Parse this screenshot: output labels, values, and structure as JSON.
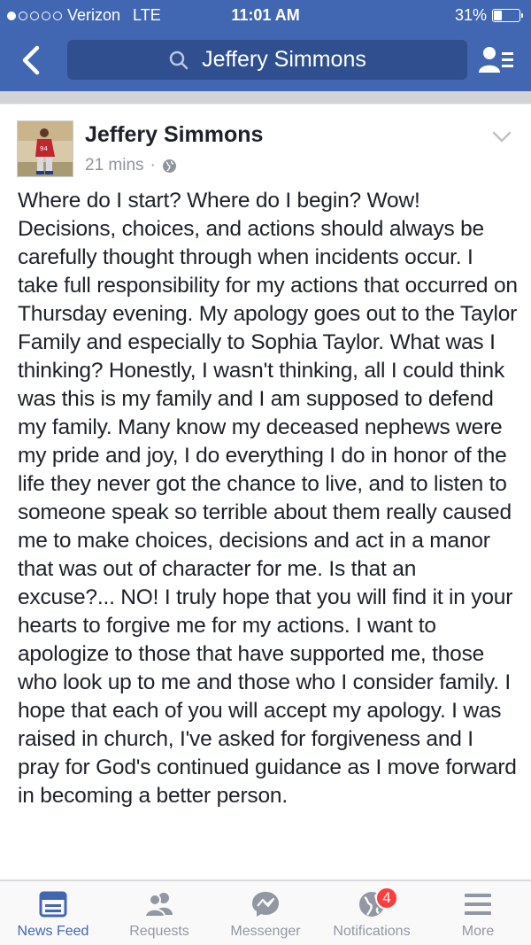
{
  "status_bar": {
    "carrier": "Verizon",
    "network": "LTE",
    "time": "11:01 AM",
    "battery": "31%",
    "battery_level": 0.31,
    "signal_bars_filled": 1
  },
  "nav": {
    "search_text": "Jeffery Simmons"
  },
  "post": {
    "author": "Jeffery Simmons",
    "time": "21 mins",
    "separator": "·",
    "audience_icon": "globe-icon",
    "text": "Where do I start? Where do I begin? Wow! Decisions, choices, and actions should always be carefully thought through when incidents occur. I take full responsibility for my actions that occurred on Thursday evening. My apology goes out to the Taylor Family and especially to Sophia Taylor. What was I thinking? Honestly, I wasn't thinking, all I could think was this is my family and I am supposed to defend my family. Many know my deceased nephews were my pride and joy, I do everything I do in honor of the life they never got the chance to live, and to listen to someone speak so terrible about them really caused me to make choices, decisions and act in a manor that was out of character for me. Is that an excuse?... NO! I truly hope that you will find it in your hearts to forgive me for my actions. I want to apologize to those that have supported me, those who look up to me and those who I consider family. I hope that each of you will accept my apology. I was raised in church, I've asked for forgiveness and I pray for God's continued guidance as I move forward in becoming a better person."
  },
  "tabs": [
    {
      "label": "News Feed",
      "icon": "news-feed-icon",
      "active": true
    },
    {
      "label": "Requests",
      "icon": "friend-requests-icon"
    },
    {
      "label": "Messenger",
      "icon": "messenger-icon"
    },
    {
      "label": "Notifications",
      "icon": "globe-icon",
      "badge": "4"
    },
    {
      "label": "More",
      "icon": "menu-icon"
    }
  ],
  "colors": {
    "brand_blue": "#4267b2",
    "search_bg": "#2f4f8f",
    "badge_red": "#fa3e3e",
    "inactive_gray": "#9197a3"
  }
}
